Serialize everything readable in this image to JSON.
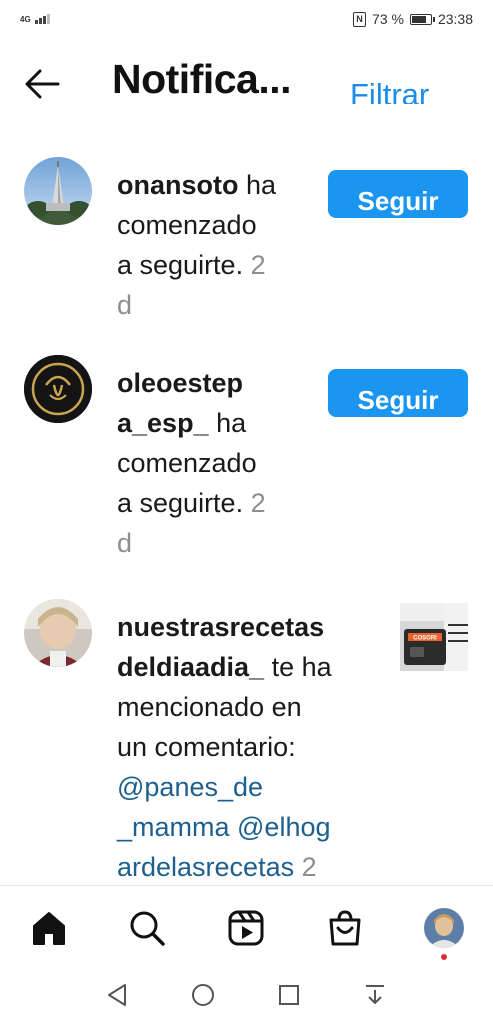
{
  "status_bar": {
    "network": "4G",
    "battery": "73 %",
    "time": "23:38",
    "icons": [
      "signal-icon",
      "nfc-icon",
      "battery-icon"
    ]
  },
  "header": {
    "title": "Notifica...",
    "filter_label": "Filtrar",
    "back_icon": "arrow-left-icon"
  },
  "notifications": [
    {
      "username": "onansoto",
      "lines": [
        "ha",
        "comenzado",
        "a seguirte.",
        "d"
      ],
      "time": "2",
      "action_label": "Seguir"
    },
    {
      "username_part1": "oleoestep",
      "username_part2": "a_esp_",
      "lines": [
        "ha",
        "comenzado",
        "a seguirte.",
        "d"
      ],
      "time": "2",
      "action_label": "Seguir"
    },
    {
      "username_part1": "nuestrasrecetas",
      "username_part2": "deldiaadia_",
      "lines": [
        "te ha",
        "mencionado en",
        "un comentario:"
      ],
      "mention_1": "@panes_de",
      "mention_2": "_mamma @elhog",
      "mention_3": "ardelasrecetas",
      "time": "2",
      "thumb_text": "COSORI"
    }
  ],
  "bottom_nav": {
    "items": [
      "home-icon",
      "search-icon",
      "reels-icon",
      "shop-icon",
      "profile-avatar"
    ],
    "active": "home-icon"
  },
  "system_nav": {
    "items": [
      "back-triangle-icon",
      "home-circle-icon",
      "recents-square-icon",
      "notification-pull-icon"
    ]
  },
  "colors": {
    "accent": "#1a95f0",
    "link": "#1d5f8e",
    "muted": "#8e8e8e",
    "badge": "#e8273b"
  }
}
